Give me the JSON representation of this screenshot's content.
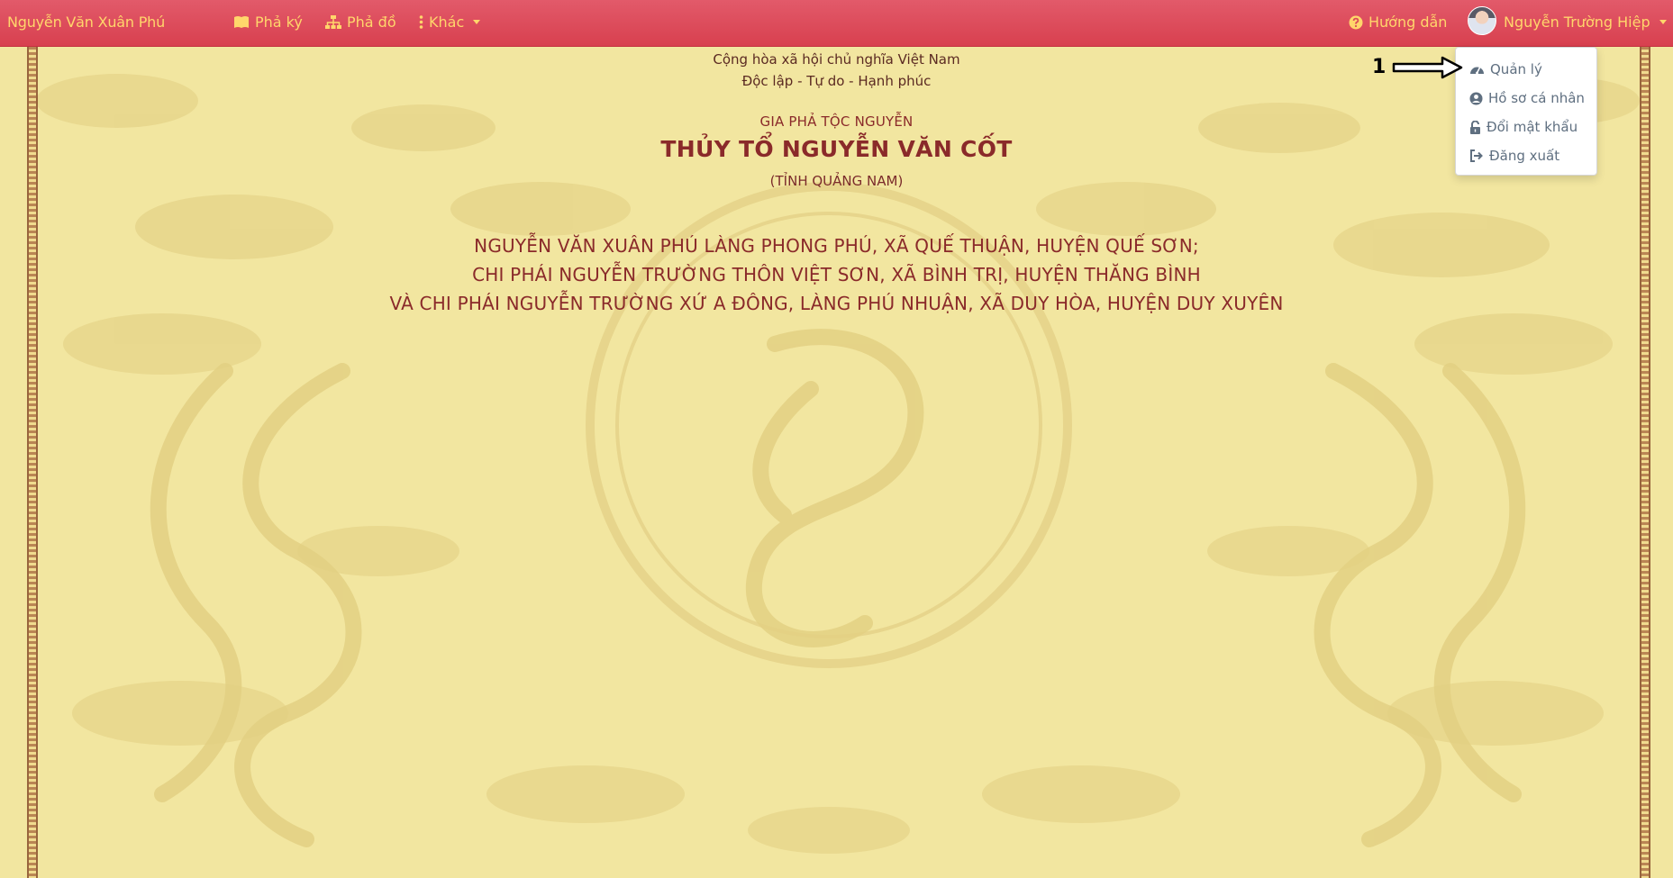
{
  "navbar": {
    "brand": "Nguyễn Văn Xuân Phú",
    "items": [
      {
        "label": "Phả ký",
        "icon": "book-icon"
      },
      {
        "label": "Phả đồ",
        "icon": "sitemap-icon"
      },
      {
        "label": "Khác",
        "icon": "vertical-ellipsis-icon"
      }
    ],
    "help_label": "Hướng dẫn",
    "user_name": "Nguyễn Trường Hiệp"
  },
  "dropdown": {
    "items": [
      {
        "label": "Quản lý",
        "icon": "dashboard-icon"
      },
      {
        "label": "Hồ sơ cá nhân",
        "icon": "user-circle-icon"
      },
      {
        "label": "Đổi mật khẩu",
        "icon": "unlock-icon"
      },
      {
        "label": "Đăng xuất",
        "icon": "sign-out-icon"
      }
    ]
  },
  "annotation": {
    "number": "1"
  },
  "document": {
    "motto_line1": "Cộng hòa xã hội chủ nghĩa Việt Nam",
    "motto_line2": "Độc lập - Tự do - Hạnh phúc",
    "label": "GIA PHẢ TỘC NGUYỄN",
    "title": "THỦY TỔ NGUYỄN VĂN CỐT",
    "province": "(TỈNH QUẢNG NAM)",
    "lines": [
      "NGUYỄN VĂN XUÂN PHÚ LÀNG PHONG PHÚ, XÃ QUẾ THUẬN, HUYỆN QUẾ SƠN;",
      "CHI PHÁI NGUYỄN TRƯỜNG THÔN VIỆT SƠN, XÃ BÌNH TRỊ, HUYỆN THĂNG BÌNH",
      "VÀ CHI PHÁI NGUYỄN TRƯỜNG XỨ A ĐÔNG, LÀNG PHÚ NHUẬN, XÃ DUY HÒA, HUYỆN DUY XUYÊN"
    ]
  },
  "colors": {
    "navbar": "#dc4a59",
    "nav_text": "#ffd66b",
    "paper": "#f2e6a0",
    "title_text": "#8a2a2a"
  }
}
